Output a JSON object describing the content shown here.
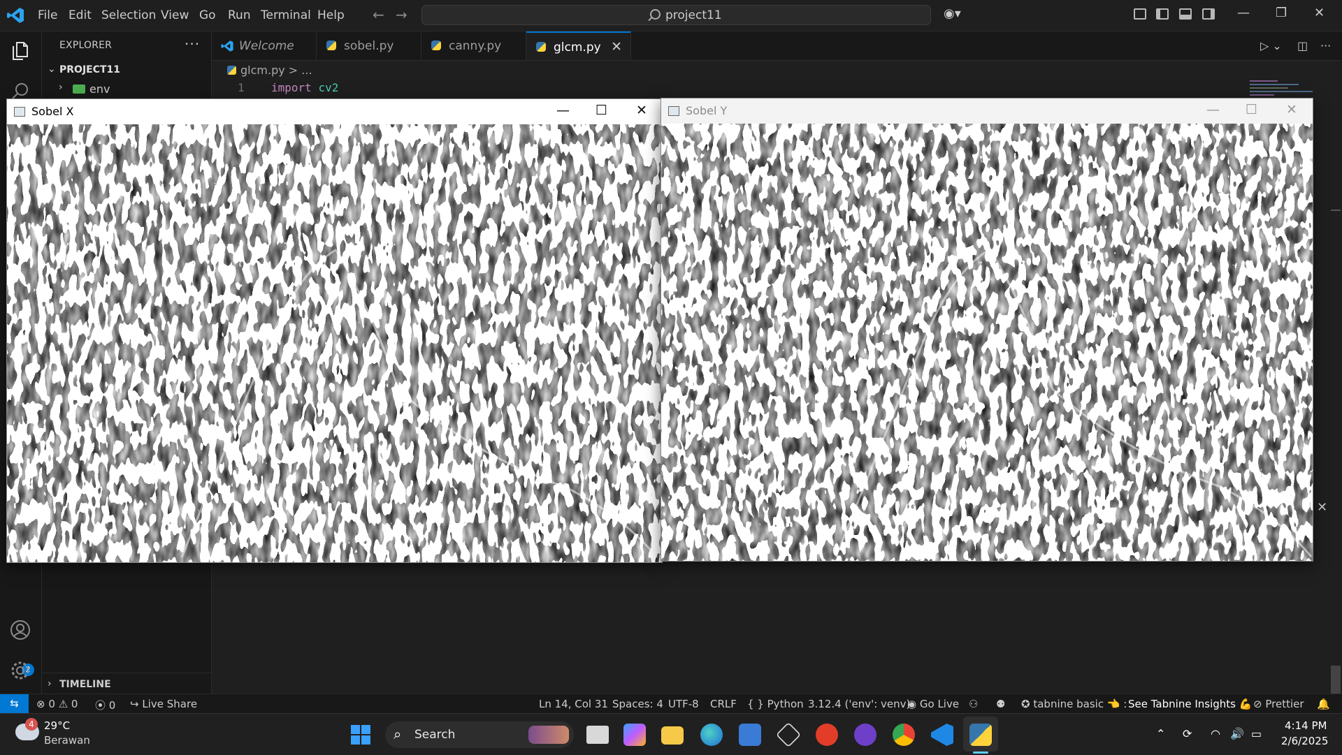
{
  "titlebar": {
    "menu": [
      "File",
      "Edit",
      "Selection",
      "View",
      "Go",
      "Run",
      "Terminal",
      "Help"
    ],
    "search_text": "project11",
    "accent": "#0078d4"
  },
  "sidebar": {
    "title": "EXPLORER",
    "project": "PROJECT11",
    "items": [
      {
        "label": "env",
        "icon": "folder-icon"
      }
    ],
    "timeline": "TIMELINE",
    "accounts_badge": "2"
  },
  "tabs": [
    {
      "label": "Welcome",
      "icon": "vscode-icon",
      "active": false
    },
    {
      "label": "sobel.py",
      "icon": "python-icon",
      "active": false
    },
    {
      "label": "canny.py",
      "icon": "python-icon",
      "active": false
    },
    {
      "label": "glcm.py",
      "icon": "python-icon",
      "active": true
    }
  ],
  "editor": {
    "breadcrumb_file": "glcm.py",
    "breadcrumb_rest": "> ...",
    "line_no": "1",
    "code_kw": "import",
    "code_mod": "cv2"
  },
  "windows": {
    "sobel_x": {
      "title": "Sobel X",
      "focused": true
    },
    "sobel_y": {
      "title": "Sobel Y",
      "focused": false
    }
  },
  "statusbar": {
    "errors": "0",
    "warnings": "0",
    "ports": "0",
    "live_share": "Live Share",
    "position": "Ln 14, Col 31",
    "spaces": "Spaces: 4",
    "encoding": "UTF-8",
    "eol": "CRLF",
    "language": "Python",
    "interpreter": "3.12.4 ('env': venv)",
    "go_live": "Go Live",
    "tabnine": "tabnine basic",
    "tabnine_insights": "See Tabnine Insights",
    "prettier": "Prettier"
  },
  "taskbar": {
    "weather_temp": "29°C",
    "weather_desc": "Berawan",
    "weather_badge": "4",
    "search_label": "Search",
    "time": "4:14 PM",
    "date": "2/6/2025"
  }
}
